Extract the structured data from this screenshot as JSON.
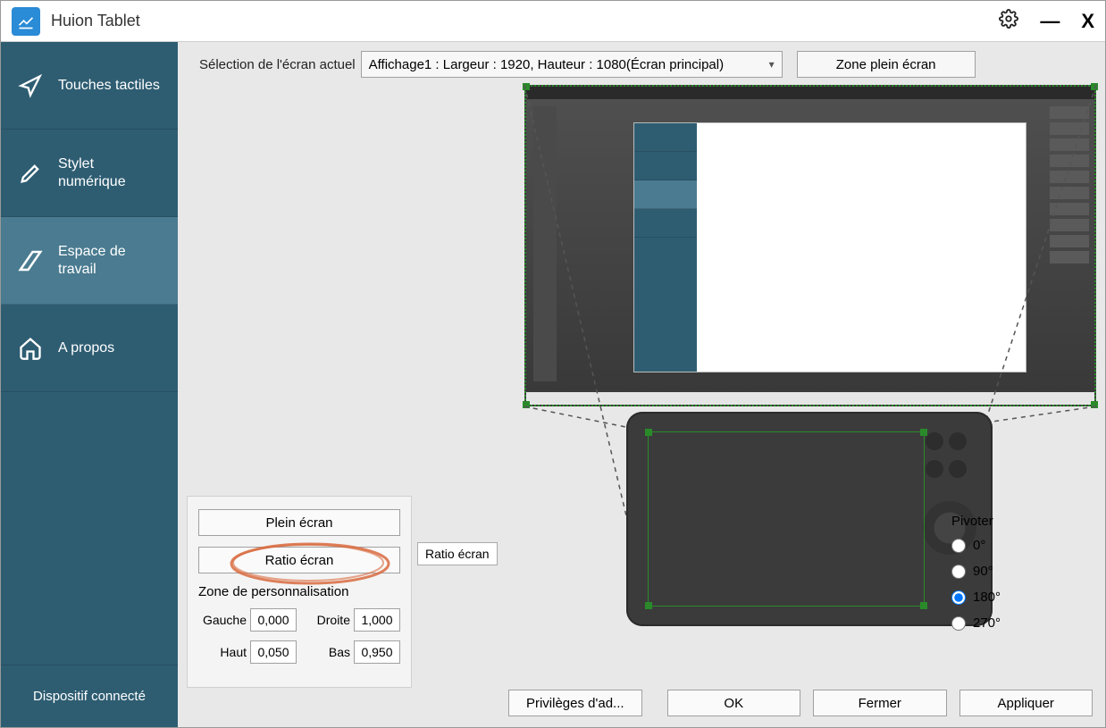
{
  "window_title": "Huion Tablet",
  "titlebar_icons": {
    "settings": "settings",
    "minimize": "minimize",
    "close": "close"
  },
  "sidebar": {
    "items": [
      {
        "id": "touches",
        "label": "Touches tactiles",
        "icon": "cursor-icon"
      },
      {
        "id": "stylet",
        "label": "Stylet numérique",
        "icon": "pencil-icon"
      },
      {
        "id": "workspace",
        "label": "Espace de travail",
        "icon": "workspace-icon",
        "selected": true
      },
      {
        "id": "about",
        "label": "A propos",
        "icon": "home-icon"
      }
    ],
    "status": "Dispositif connecté"
  },
  "top": {
    "screen_select_label": "Sélection de l'écran actuel",
    "screen_select_value": "Affichage1 : Largeur : 1920, Hauteur : 1080(Écran principal)",
    "fullscreen_zone_btn": "Zone plein écran"
  },
  "controls": {
    "full_screen_btn": "Plein écran",
    "ratio_btn": "Ratio écran",
    "ratio_tooltip": "Ratio écran",
    "custom_zone_label": "Zone de personnalisation",
    "left_label": "Gauche",
    "left_value": "0,000",
    "right_label": "Droite",
    "right_value": "1,000",
    "top_label": "Haut",
    "top_value": "0,050",
    "bottom_label": "Bas",
    "bottom_value": "0,950"
  },
  "rotate": {
    "header": "Pivoter",
    "options": [
      "0°",
      "90°",
      "180°",
      "270°"
    ],
    "selected": "180°"
  },
  "buttons": {
    "privileges": "Privilèges d'ad...",
    "ok": "OK",
    "close": "Fermer",
    "apply": "Appliquer"
  }
}
